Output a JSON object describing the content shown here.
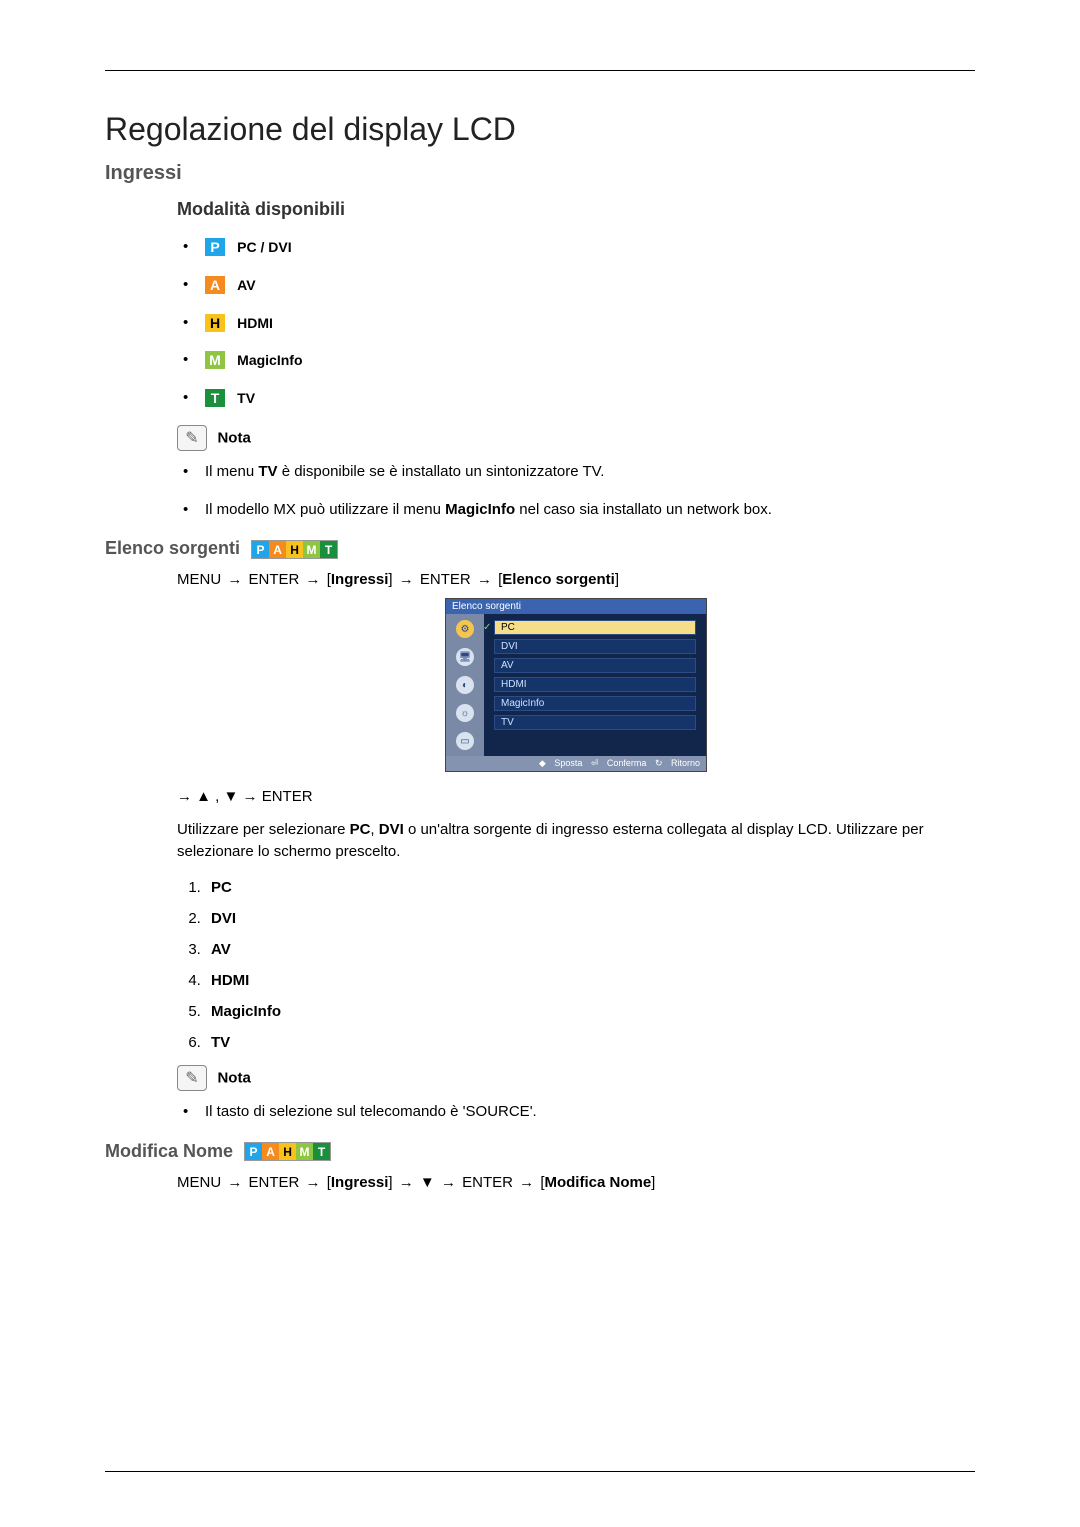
{
  "title": "Regolazione del display LCD",
  "sections": {
    "ingressi": "Ingressi",
    "modalita": "Modalità disponibili",
    "elenco": "Elenco sorgenti",
    "modifica": "Modifica Nome"
  },
  "modes": [
    {
      "badge": "P",
      "label": "PC / DVI"
    },
    {
      "badge": "A",
      "label": "AV"
    },
    {
      "badge": "H",
      "label": "HDMI"
    },
    {
      "badge": "M",
      "label": "MagicInfo"
    },
    {
      "badge": "T",
      "label": "TV"
    }
  ],
  "note_label": "Nota",
  "nota1": [
    {
      "pre": "Il menu ",
      "bold": "TV",
      "post": " è disponibile se è installato un sintonizzatore TV."
    },
    {
      "pre": "Il modello MX può utilizzare il menu ",
      "bold": "MagicInfo",
      "post": " nel caso sia installato un network box."
    }
  ],
  "path1": {
    "p": [
      "MENU",
      "→",
      "ENTER",
      "→",
      "[",
      "Ingressi",
      "]",
      "→",
      "ENTER",
      "→",
      "[",
      "Elenco sorgenti",
      "]"
    ]
  },
  "osd": {
    "title": "Elenco sorgenti",
    "items": [
      "PC",
      "DVI",
      "AV",
      "HDMI",
      "MagicInfo",
      "TV"
    ],
    "selected": 0,
    "footer": [
      "Sposta",
      "Conferma",
      "Ritorno"
    ]
  },
  "nav_hint": "→ ▲ , ▼ → ENTER",
  "para1_pre": "Utilizzare per selezionare ",
  "para1_b1": "PC",
  "para1_mid": ", ",
  "para1_b2": "DVI",
  "para1_post": " o un'altra sorgente di ingresso esterna collegata al display LCD. Utilizzare per selezionare lo schermo prescelto.",
  "source_list": [
    "PC",
    "DVI",
    "AV",
    "HDMI",
    "MagicInfo",
    "TV"
  ],
  "nota2": "Il tasto di selezione sul telecomando è 'SOURCE'.",
  "path2": {
    "p": [
      "MENU",
      "→",
      "ENTER",
      "→",
      "[",
      "Ingressi",
      "]",
      "→",
      "▼",
      "→",
      "ENTER",
      "→",
      "[",
      "Modifica Nome",
      "]"
    ]
  }
}
